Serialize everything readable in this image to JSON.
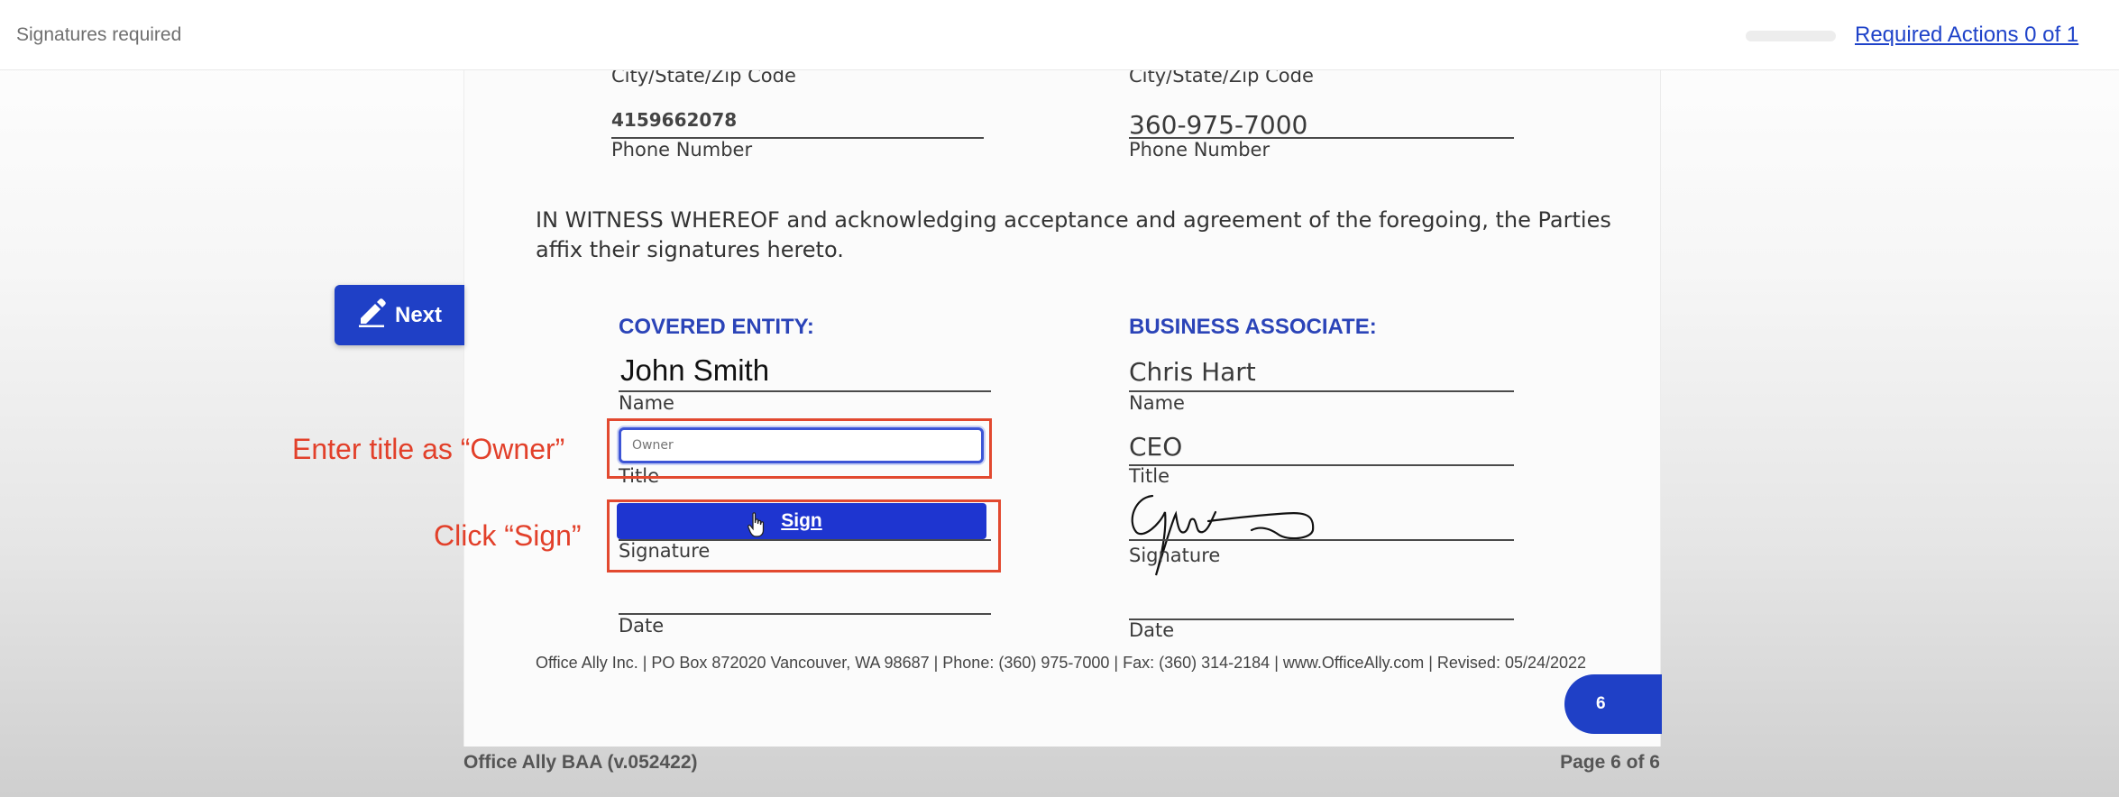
{
  "topbar": {
    "status": "Signatures required",
    "required_actions": "Required Actions 0 of 1",
    "progress": 0
  },
  "document": {
    "left_city_label": "City/State/Zip Code",
    "right_city_label": "City/State/Zip Code",
    "left_phone_value": "4159662078",
    "right_phone_value": "360-975-7000",
    "left_phone_label": "Phone Number",
    "right_phone_label": "Phone Number",
    "witness_text": "IN WITNESS WHEREOF and acknowledging acceptance and agreement of the foregoing, the Parties affix their signatures hereto.",
    "covered_entity": {
      "heading": "COVERED ENTITY:",
      "name_value": "John Smith",
      "name_label": "Name",
      "title_placeholder": "Owner",
      "title_label": "Title",
      "sign_label": "Sign",
      "signature_label": "Signature",
      "date_label": "Date"
    },
    "business_associate": {
      "heading": "BUSINESS ASSOCIATE:",
      "name_value": "Chris Hart",
      "name_label": "Name",
      "title_value": "CEO",
      "title_label": "Title",
      "signature_label": "Signature",
      "date_label": "Date"
    },
    "footer": "Office Ally Inc. | PO Box 872020 Vancouver, WA 98687 | Phone: (360) 975-7000 | Fax: (360) 314-2184 | www.OfficeAlly.com | Revised: 05/24/2022",
    "page_badge": "6"
  },
  "next_button": "Next",
  "annotations": {
    "title_hint": "Enter title as “Owner”",
    "sign_hint": "Click “Sign”"
  },
  "bottom": {
    "doc_name": "Office Ally BAA (v.052422)",
    "page_info": "Page 6 of 6"
  },
  "colors": {
    "accent": "#1f40c6",
    "annotation": "#e2402a",
    "link": "#1f43c9"
  },
  "icons": {
    "next": "pencil-icon",
    "cursor": "hand-pointer-icon"
  }
}
